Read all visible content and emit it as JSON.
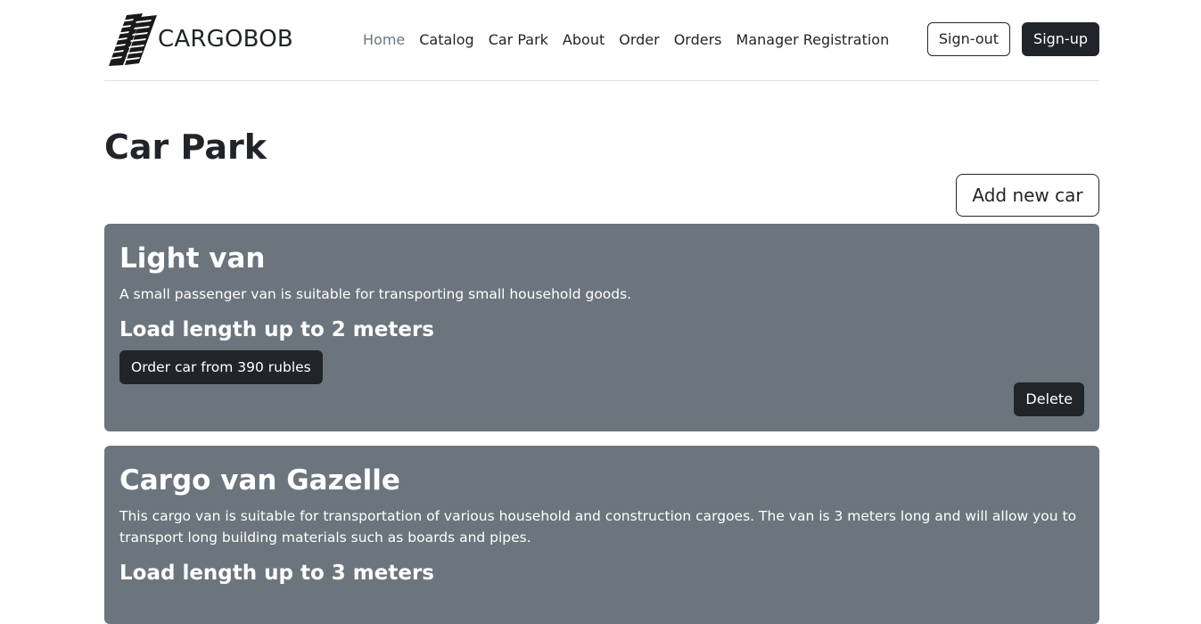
{
  "brand": {
    "name": "CARGOBOB",
    "logo_icon": "tire-track-logo"
  },
  "nav": {
    "items": [
      {
        "label": "Home",
        "active": true
      },
      {
        "label": "Catalog"
      },
      {
        "label": "Car Park"
      },
      {
        "label": "About"
      },
      {
        "label": "Order"
      },
      {
        "label": "Orders"
      },
      {
        "label": "Manager Registration"
      }
    ]
  },
  "auth": {
    "signout_label": "Sign-out",
    "signup_label": "Sign-up"
  },
  "page": {
    "title": "Car Park",
    "add_button_label": "Add new car"
  },
  "cars": [
    {
      "title": "Light van",
      "description": "A small passenger van is suitable for transporting small household goods.",
      "load_length": "Load length up to 2 meters",
      "order_label": "Order car from 390 rubles",
      "delete_label": "Delete"
    },
    {
      "title": "Cargo van Gazelle",
      "description": "This cargo van is suitable for transportation of various household and construction cargoes. The van is 3 meters long and will allow you to transport long building materials such as boards and pipes.",
      "load_length": "Load length up to 3 meters"
    }
  ],
  "colors": {
    "card_bg": "#6c757d",
    "dark": "#212529",
    "muted": "#6c757d",
    "border": "#dee2e6"
  }
}
